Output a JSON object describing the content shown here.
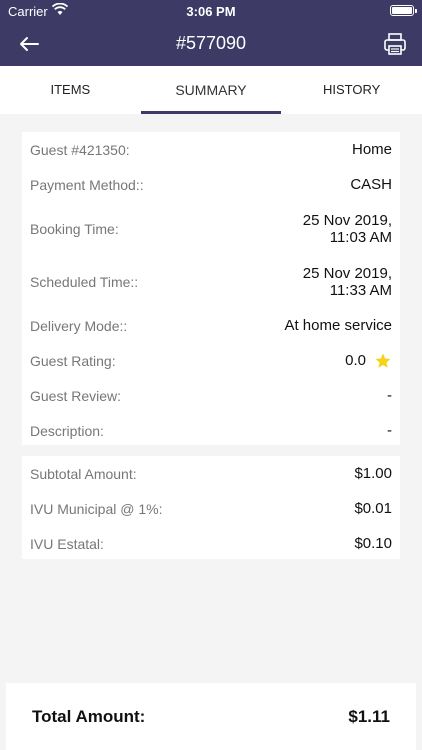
{
  "status_bar": {
    "carrier": "Carrier",
    "time": "3:06 PM"
  },
  "header": {
    "title": "#577090"
  },
  "tabs": [
    {
      "label": "ITEMS"
    },
    {
      "label": "SUMMARY"
    },
    {
      "label": "HISTORY"
    }
  ],
  "details": [
    {
      "label": "Guest #421350:",
      "value": "Home"
    },
    {
      "label": "Payment Method::",
      "value": "CASH"
    },
    {
      "label": "Booking Time:",
      "value_line1": "25 Nov 2019,",
      "value_line2": "11:03 AM"
    },
    {
      "label": "Scheduled Time::",
      "value_line1": "25 Nov 2019,",
      "value_line2": "11:33 AM"
    },
    {
      "label": "Delivery Mode::",
      "value": "At home service"
    },
    {
      "label": "Guest Rating:",
      "value": "0.0"
    },
    {
      "label": "Guest Review:",
      "value": "-"
    },
    {
      "label": "Description:",
      "value": "-"
    }
  ],
  "amounts": [
    {
      "label": "Subtotal Amount:",
      "value": "$1.00"
    },
    {
      "label": "IVU Municipal @ 1%:",
      "value": "$0.01"
    },
    {
      "label": "IVU Estatal:",
      "value": "$0.10"
    }
  ],
  "total": {
    "label": "Total Amount:",
    "value": "$1.11"
  },
  "colors": {
    "header": "#3d3a66",
    "star": "#f4d31a"
  }
}
